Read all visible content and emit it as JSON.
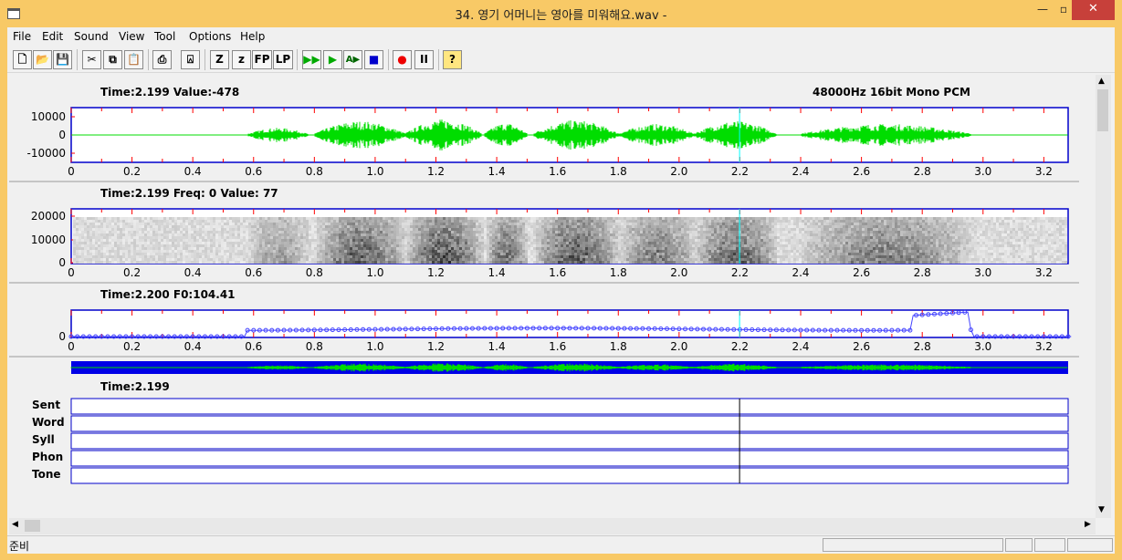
{
  "window": {
    "title": "34. 영기 어머니는 영아를 미워해요.wav -",
    "minimize": "—",
    "maximize": "▫",
    "close": "✕"
  },
  "menu": [
    "File",
    "Edit",
    "Sound",
    "View",
    "Tool",
    "Options",
    "Help"
  ],
  "toolbar": {
    "buttons": [
      {
        "name": "new-button",
        "glyph": "🗋"
      },
      {
        "name": "open-button",
        "glyph": "📂"
      },
      {
        "name": "save-button",
        "glyph": "💾"
      },
      {
        "name": "cut-button",
        "glyph": "✂"
      },
      {
        "name": "copy-button",
        "glyph": "⧉"
      },
      {
        "name": "paste-button",
        "glyph": "📋"
      },
      {
        "name": "print-button",
        "glyph": "⎙"
      },
      {
        "name": "label-button",
        "glyph": "⍓"
      },
      {
        "name": "zoom-in-button",
        "glyph": "Z"
      },
      {
        "name": "zoom-out-button",
        "glyph": "z"
      },
      {
        "name": "fp-button",
        "glyph": "FP"
      },
      {
        "name": "lp-button",
        "glyph": "LP"
      },
      {
        "name": "play-all-button",
        "glyph": "▶▶"
      },
      {
        "name": "play-button",
        "glyph": "▶"
      },
      {
        "name": "play-ab-button",
        "glyph": "A▶"
      },
      {
        "name": "stop-button",
        "glyph": "■"
      },
      {
        "name": "record-button",
        "glyph": "●"
      },
      {
        "name": "pause-button",
        "glyph": "II"
      },
      {
        "name": "help-button",
        "glyph": "?"
      }
    ]
  },
  "waveform": {
    "readout": "Time:2.199 Value:-478",
    "format": "48000Hz 16bit Mono PCM",
    "y_ticks": [
      "10000",
      "0",
      "-10000"
    ]
  },
  "spectrogram": {
    "readout": "Time:2.199 Freq:    0 Value:  77",
    "y_ticks": [
      "20000",
      "10000",
      "0"
    ]
  },
  "pitch": {
    "readout": "Time:2.200  F0:104.41",
    "y_ticks": [
      "0"
    ]
  },
  "x_ticks": [
    "0",
    "0.2",
    "0.4",
    "0.6",
    "0.8",
    "1.0",
    "1.2",
    "1.4",
    "1.6",
    "1.8",
    "2.0",
    "2.2",
    "2.4",
    "2.6",
    "2.8",
    "3.0",
    "3.2"
  ],
  "cursor_time": 2.199,
  "duration": 3.28,
  "annotation": {
    "readout": "Time:2.199",
    "tiers": [
      "Sent",
      "Word",
      "Syll",
      "Phon",
      "Tone"
    ]
  },
  "status": {
    "text": "준비"
  },
  "colors": {
    "frame": "#f8c966",
    "wave": "#00dd00",
    "axis": "#0000cc",
    "tick_red": "#ff0000",
    "cursor": "#00ffff",
    "pitch": "#4444ff"
  }
}
